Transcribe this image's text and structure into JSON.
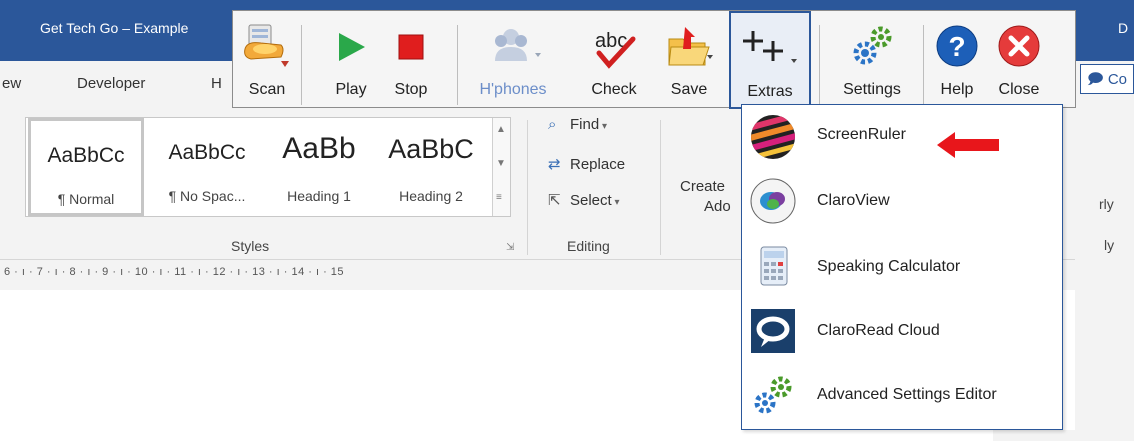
{
  "window": {
    "title": "Get Tech Go – Example",
    "right_char": "D"
  },
  "ribbon_tabs": [
    {
      "label": "ew"
    },
    {
      "label": "Developer"
    },
    {
      "label": "H"
    }
  ],
  "styles_gallery": {
    "items": [
      {
        "sample": "AaBbCc",
        "name": "¶ Normal"
      },
      {
        "sample": "AaBbCc",
        "name": "¶ No Spac..."
      },
      {
        "sample": "AaBb",
        "name": "Heading 1"
      },
      {
        "sample": "AaBbC",
        "name": "Heading 2"
      }
    ],
    "group_label": "Styles"
  },
  "editing_group": {
    "find": "Find",
    "replace": "Replace",
    "select": "Select",
    "label": "Editing"
  },
  "create_group": {
    "line1": "Create",
    "line2": "Ado"
  },
  "ruler": {
    "text": "6 · ı · 7 · ı · 8 · ı · 9 · ı · 10 · ı · 11 · ı · 12 · ı · 13 · ı · 14 · ı · 15"
  },
  "comments_button": {
    "label": "Co"
  },
  "right_partial": {
    "a": "rly",
    "b": "ly"
  },
  "toolbar": {
    "buttons": [
      {
        "label": "Scan",
        "icon": "scanner-icon"
      },
      {
        "label": "Play",
        "icon": "play-icon"
      },
      {
        "label": "Stop",
        "icon": "stop-icon"
      },
      {
        "label": "H'phones",
        "icon": "headphones-icon"
      },
      {
        "label": "Check",
        "icon": "spellcheck-icon"
      },
      {
        "label": "Save",
        "icon": "save-folder-icon"
      },
      {
        "label": "Extras",
        "icon": "extras-plus-icon"
      },
      {
        "label": "Settings",
        "icon": "gears-icon"
      },
      {
        "label": "Help",
        "icon": "help-icon"
      },
      {
        "label": "Close",
        "icon": "close-icon"
      }
    ]
  },
  "extras_menu": {
    "items": [
      {
        "label": "ScreenRuler",
        "icon": "screenruler-icon"
      },
      {
        "label": "ClaroView",
        "icon": "claroview-icon"
      },
      {
        "label": "Speaking Calculator",
        "icon": "calculator-icon"
      },
      {
        "label": "ClaroRead Cloud",
        "icon": "cloud-speech-icon"
      },
      {
        "label": "Advanced Settings Editor",
        "icon": "gears-icon"
      }
    ]
  },
  "colors": {
    "word_blue": "#2b579a",
    "ribbon_bg": "#f3f3f3",
    "arrow_red": "#e8161b",
    "disabled_blue": "#6c8ec9"
  }
}
